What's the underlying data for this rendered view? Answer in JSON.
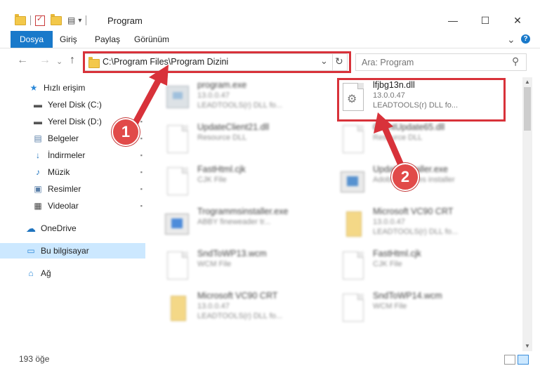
{
  "window": {
    "title": "Program",
    "minimize_glyph": "—",
    "maximize_glyph": "☐",
    "close_glyph": "✕"
  },
  "ribbon": {
    "tabs": [
      {
        "label": "Dosya",
        "active": true
      },
      {
        "label": "Giriş"
      },
      {
        "label": "Paylaş"
      },
      {
        "label": "Görünüm"
      }
    ],
    "expand_glyph": "⌄",
    "help_glyph": "?"
  },
  "navigation": {
    "back_glyph": "←",
    "forward_glyph": "→",
    "recent_glyph": "⌄",
    "up_glyph": "↑",
    "address": "C:\\Program Files\\Program Dizini",
    "dropdown_glyph": "⌄",
    "refresh_glyph": "↻",
    "search_placeholder": "Ara: Program",
    "search_glyph": "⚲"
  },
  "sidebar": {
    "items": [
      {
        "label": "Hızlı erişim",
        "icon": "star-icon",
        "glyph": "★",
        "color": "#2b88d8"
      },
      {
        "label": "Yerel Disk (C:)",
        "icon": "drive-icon",
        "glyph": "▬",
        "pinned": false
      },
      {
        "label": "Yerel Disk (D:)",
        "icon": "drive-icon",
        "glyph": "▬",
        "pinned": true
      },
      {
        "label": "Belgeler",
        "icon": "documents-icon",
        "glyph": "▤",
        "pinned": true
      },
      {
        "label": "İndirmeler",
        "icon": "download-icon",
        "glyph": "↓",
        "pinned": true
      },
      {
        "label": "Müzik",
        "icon": "music-icon",
        "glyph": "♪",
        "pinned": true
      },
      {
        "label": "Resimler",
        "icon": "pictures-icon",
        "glyph": "▣",
        "pinned": true
      },
      {
        "label": "Videolar",
        "icon": "video-icon",
        "glyph": "▦",
        "pinned": true
      },
      {
        "label": "OneDrive",
        "icon": "cloud-icon",
        "glyph": "☁",
        "color": "#1e73be"
      },
      {
        "label": "Bu bilgisayar",
        "icon": "computer-icon",
        "glyph": "▭",
        "selected": true
      },
      {
        "label": "Ağ",
        "icon": "network-icon",
        "glyph": "⌂"
      }
    ],
    "pin_glyph": "📌"
  },
  "files": [
    {
      "name": "program.exe",
      "line2": "13.0.0.47",
      "line3": "LEADTOOLS(r) DLL fo...",
      "icon": "exe-icon",
      "blurred": true
    },
    {
      "name": "lfjbg13n.dll",
      "line2": "13.0.0.47",
      "line3": "LEADTOOLS(r) DLL fo...",
      "icon": "dll-gear-icon",
      "blurred": false
    },
    {
      "name": "UpdateClient21.dll",
      "line2": "Resource DLL",
      "line3": "",
      "icon": "dll-icon",
      "blurred": true
    },
    {
      "name": "ClientUpdate65.dll",
      "line2": "Resource DLL",
      "line3": "",
      "icon": "dll-icon",
      "blurred": true
    },
    {
      "name": "FastHtml.cjk",
      "line2": "CJK File",
      "line3": "",
      "icon": "file-icon",
      "blurred": true
    },
    {
      "name": "UpdateInstaller.exe",
      "line2": "Adobe Updates installer",
      "line3": "",
      "icon": "installer-icon",
      "blurred": true
    },
    {
      "name": "Trogrammsinstaller.exe",
      "line2": "ABBY fineweader tr...",
      "line3": "",
      "icon": "installer-icon",
      "blurred": true
    },
    {
      "name": "Microsoft VC90 CRT",
      "line2": "13.0.0.47",
      "line3": "LEADTOOLS(r) DLL fo...",
      "icon": "manifest-icon",
      "blurred": true
    },
    {
      "name": "SndToWP13.wcm",
      "line2": "WCM File",
      "line3": "",
      "icon": "file-icon",
      "blurred": true
    },
    {
      "name": "FastHtml.cjk",
      "line2": "CJK File",
      "line3": "",
      "icon": "file-icon",
      "blurred": true
    },
    {
      "name": "Microsoft VC90 CRT",
      "line2": "13.0.0.47",
      "line3": "LEADTOOLS(r) DLL fo...",
      "icon": "manifest-icon",
      "blurred": true
    },
    {
      "name": "SndToWP14.wcm",
      "line2": "WCM File",
      "line3": "",
      "icon": "file-icon",
      "blurred": true
    }
  ],
  "status": {
    "item_count": "193 öğe"
  },
  "annotations": {
    "step1": "1",
    "step2": "2",
    "color": "#d8323a"
  }
}
